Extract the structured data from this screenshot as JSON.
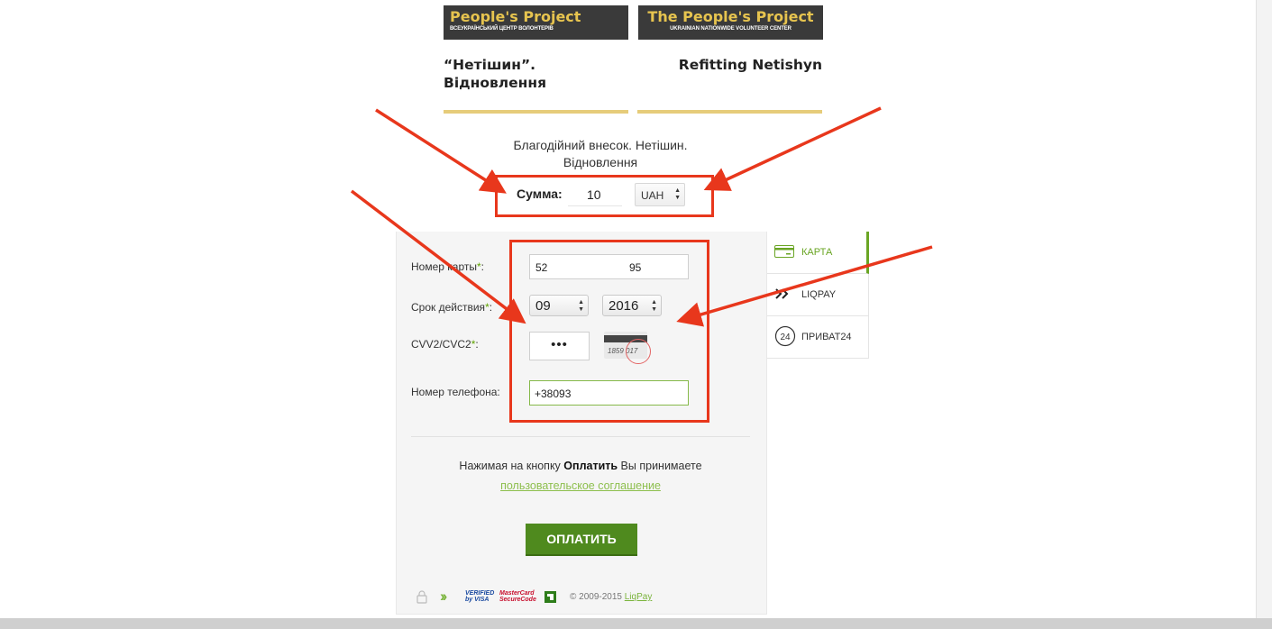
{
  "logos": {
    "ua": {
      "name": "People's Project",
      "tagline": "ВСЕУКРАЇНСЬКИЙ ЦЕНТР ВОЛОНТЕРІВ"
    },
    "en": {
      "name": "The People's Project",
      "tagline": "UKRAINIAN NATIONWIDE VOLUNTEER CENTER"
    }
  },
  "project": {
    "title_ua_line1": "“Нетішин”.",
    "title_ua_line2": "Відновлення",
    "title_en": "Refitting Netishyn"
  },
  "payment": {
    "description_line1": "Благодійний внесок. Нетішин.",
    "description_line2": "Відновлення",
    "amount_label": "Сумма:",
    "amount_value": "10",
    "currency": "UAH"
  },
  "form": {
    "card_number_label": "Номер карты",
    "card_number_part1": "52",
    "card_number_part2": "95",
    "expiry_label": "Срок действия",
    "expiry_month": "09",
    "expiry_year": "2016",
    "cvv_label": "CVV2/CVC2",
    "cvv_value": "•••",
    "cvv_card_text": "1859  017",
    "phone_label": "Номер телефона:",
    "phone_value": "+38093",
    "required_mark": "*",
    "colon": ":"
  },
  "terms": {
    "prefix": "Нажимая на кнопку ",
    "button_ref": "Оплатить",
    "suffix": " Вы принимаете",
    "link": "пользовательское соглашение"
  },
  "pay_button": "ОПЛАТИТЬ",
  "footer": {
    "verified_line1": "VERIFIED",
    "verified_line2": "by VISA",
    "mc_line1": "MasterCard",
    "mc_line2": "SecureCode",
    "copyright": "© 2009-2015 ",
    "copyright_link": "LiqPay"
  },
  "tabs": [
    {
      "label": "КАРТА",
      "icon": "card-icon",
      "active": true
    },
    {
      "label": "LIQPAY",
      "icon": "liqpay-chevron-icon",
      "active": false
    },
    {
      "label": "ПРИВАТ24",
      "icon": "privat24-icon",
      "active": false
    }
  ],
  "privat24_icon_text": "24",
  "colors": {
    "accent_green": "#6aa524",
    "pay_button": "#4f8a1e",
    "annotation_red": "#e8371c",
    "logo_gold": "#e7c44f",
    "gold_line": "#e6cc7a"
  }
}
